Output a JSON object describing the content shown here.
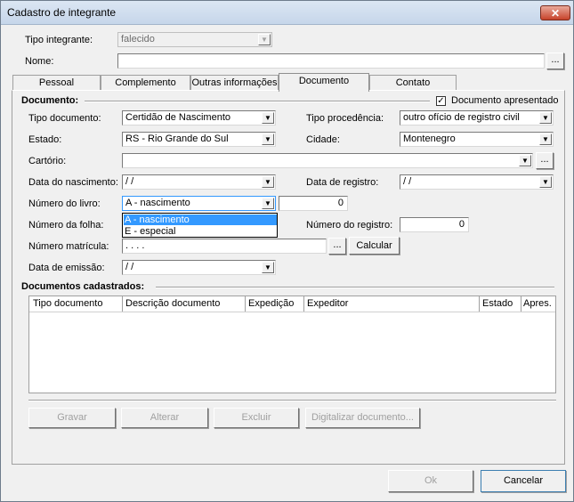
{
  "window": {
    "title": "Cadastro de integrante",
    "close_glyph": "✕"
  },
  "header": {
    "tipo_integrante_label": "Tipo integrante:",
    "tipo_integrante_value": "falecido",
    "nome_label": "Nome:",
    "nome_value": "",
    "nome_browse": "..."
  },
  "tabs": [
    {
      "label": "Pessoal"
    },
    {
      "label": "Complemento"
    },
    {
      "label": "Outras informações"
    },
    {
      "label": "Documento"
    },
    {
      "label": "Contato"
    }
  ],
  "documento": {
    "group_label": "Documento:",
    "apresentado_label": "Documento apresentado",
    "apresentado_checked": true,
    "check_glyph": "✓",
    "tipo_documento_label": "Tipo documento:",
    "tipo_documento_value": "Certidão de Nascimento",
    "tipo_procedencia_label": "Tipo procedência:",
    "tipo_procedencia_value": "outro ofício de registro civil",
    "estado_label": "Estado:",
    "estado_value": "RS - Rio Grande do Sul",
    "cidade_label": "Cidade:",
    "cidade_value": "Montenegro",
    "cartorio_label": "Cartório:",
    "cartorio_value": "",
    "cartorio_browse": "...",
    "data_nascimento_label": "Data do nascimento:",
    "data_nascimento_value": " /  /",
    "data_registro_label": "Data de registro:",
    "data_registro_value": " /  /",
    "numero_livro_label": "Número do livro:",
    "numero_livro_value": "A - nascimento",
    "numero_livro_num": "0",
    "livro_options": [
      "A - nascimento",
      "E - especial"
    ],
    "numero_folha_label": "Número da folha:",
    "numero_registro_label": "Número do registro:",
    "numero_registro_value": "0",
    "numero_matricula_label": "Número matrícula:",
    "numero_matricula_value": "      .       .     .       .",
    "matricula_browse": "...",
    "calcular_label": "Calcular",
    "data_emissao_label": "Data de emissão:",
    "data_emissao_value": " /  /"
  },
  "cadastrados": {
    "group_label": "Documentos cadastrados:",
    "columns": [
      "Tipo documento",
      "Descrição documento",
      "Expedição",
      "Expeditor",
      "Estado",
      "Apres."
    ]
  },
  "actions": {
    "gravar": "Gravar",
    "alterar": "Alterar",
    "excluir": "Excluir",
    "digitalizar": "Digitalizar documento..."
  },
  "footer": {
    "ok": "Ok",
    "cancelar": "Cancelar"
  },
  "icons": {
    "dropdown_arrow": "▼"
  }
}
